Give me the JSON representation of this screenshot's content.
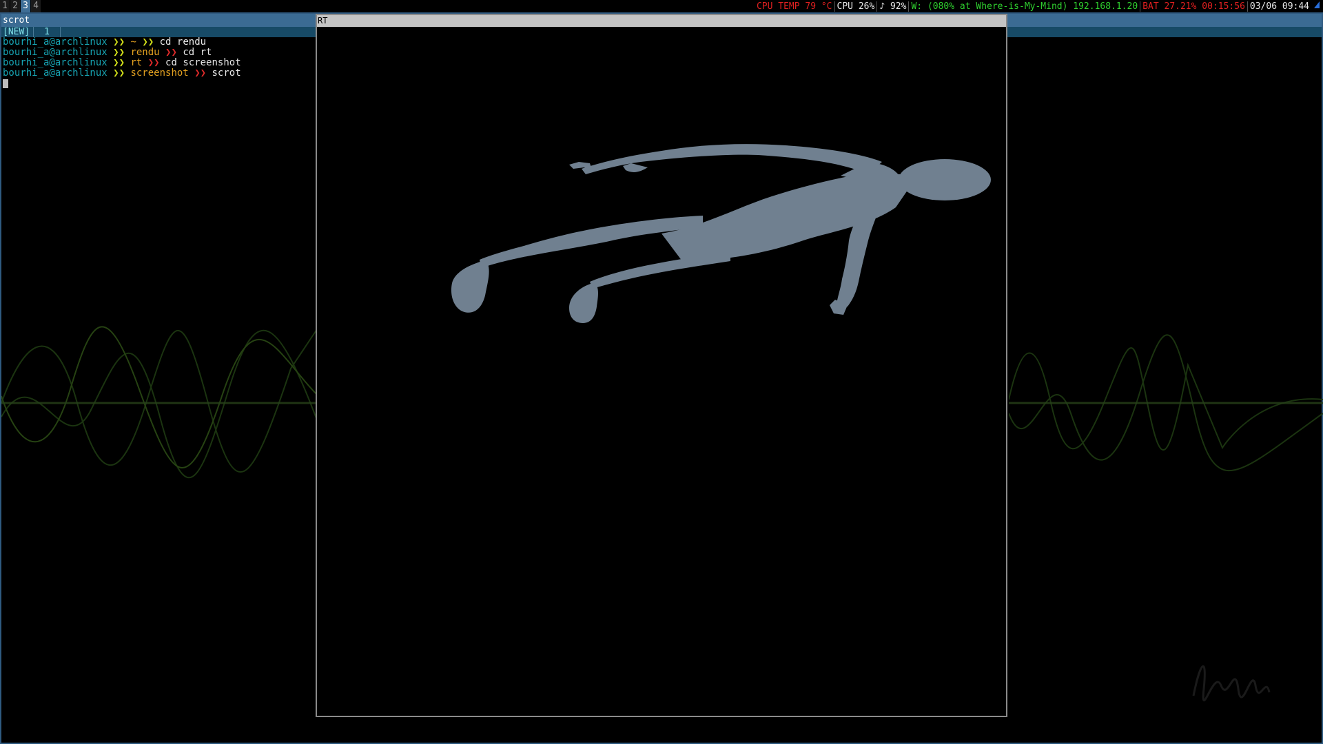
{
  "topbar": {
    "workspaces": [
      {
        "label": "1",
        "active": false
      },
      {
        "label": "2",
        "active": false
      },
      {
        "label": "3",
        "active": true
      },
      {
        "label": "4",
        "active": false
      }
    ],
    "cpu_temp": "CPU TEMP 79 °C",
    "cpu_usage": "CPU 26%",
    "volume": "♪ 92%",
    "wifi_label": "W:",
    "wifi_detail": "(080% at Where-is-My-Mind)",
    "ip": "192.168.1.20",
    "battery": "BAT 27.21% 00:15:56",
    "datetime": "03/06 09:44",
    "volume_icon": "speaker-icon",
    "colors": {
      "alert": "#e02020",
      "ok": "#2fd02f",
      "active_ws": "#3f6e96"
    }
  },
  "terminal": {
    "title": "scrot",
    "tabs": [
      "[NEW]",
      "1"
    ],
    "lines": [
      {
        "user": "bourhi_a@archlinux",
        "sep1": "❯❯",
        "cwd": "~",
        "sep2": "❯❯",
        "cmd": "cd rendu"
      },
      {
        "user": "bourhi_a@archlinux",
        "sep1": "❯❯",
        "cwd": "rendu",
        "sep2": "❯❯",
        "cmd": "cd rt"
      },
      {
        "user": "bourhi_a@archlinux",
        "sep1": "❯❯",
        "cwd": "rt",
        "sep2": "❯❯",
        "cmd": "cd screenshot"
      },
      {
        "user": "bourhi_a@archlinux",
        "sep1": "❯❯",
        "cwd": "screenshot",
        "sep2": "❯❯",
        "cmd": "scrot"
      }
    ]
  },
  "rt_window": {
    "title": "RT",
    "render_subject": "floating-human-silhouette",
    "render_color": "#708090"
  }
}
